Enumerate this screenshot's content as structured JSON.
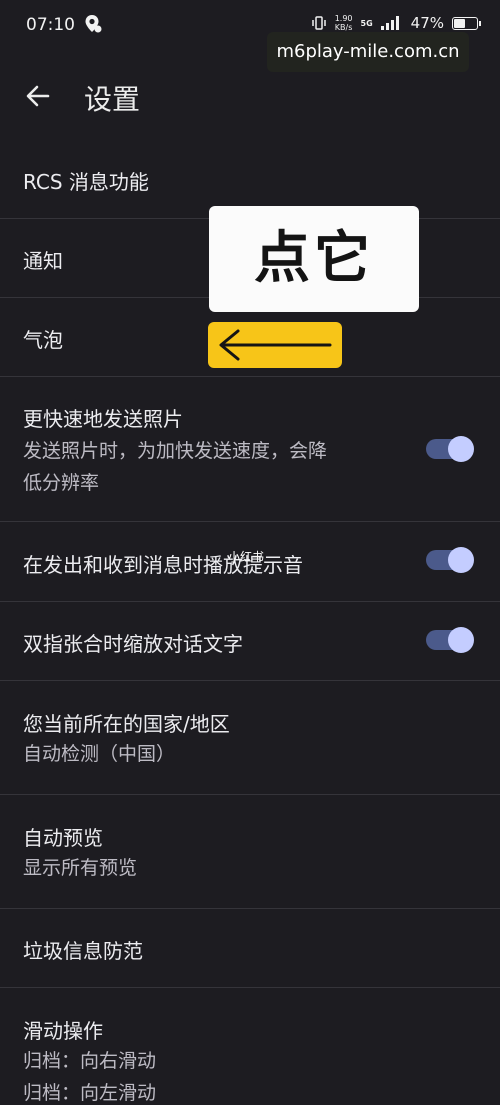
{
  "status_bar": {
    "time": "07:10",
    "net_speed_value": "1.90",
    "net_speed_unit": "KB/s",
    "network": "5G",
    "battery": "47%"
  },
  "watermark": "m6play-mile.com.cn",
  "app_bar": {
    "back_icon": "arrow-left-icon",
    "title": "设置"
  },
  "settings": [
    {
      "title": "RCS 消息功能"
    },
    {
      "title": "通知"
    },
    {
      "title": "气泡"
    },
    {
      "title": "更快速地发送照片",
      "sub1": "发送照片时，为加快发送速度，会降",
      "sub2": "低分辨率",
      "toggle_on": true
    },
    {
      "title": "在发出和收到消息时播放提示音",
      "toggle_on": true
    },
    {
      "title": "双指张合时缩放对话文字",
      "toggle_on": true
    },
    {
      "title": "您当前所在的国家/地区",
      "sub1": "自动检测（中国）"
    },
    {
      "title": "自动预览",
      "sub1": "显示所有预览"
    },
    {
      "title": "垃圾信息防范"
    },
    {
      "title": "滑动操作",
      "sub1": "归档：向右滑动",
      "sub2": "归档：向左滑动"
    }
  ],
  "annotation": {
    "callout_text": "点它",
    "arrow_icon": "arrow-left-icon",
    "overlay_text": "小红书"
  },
  "colors": {
    "background": "#1d1c21",
    "toggle_track": "#4b5a8b",
    "toggle_thumb": "#c4cdff",
    "callout_arrow_bg": "#f7c518"
  }
}
